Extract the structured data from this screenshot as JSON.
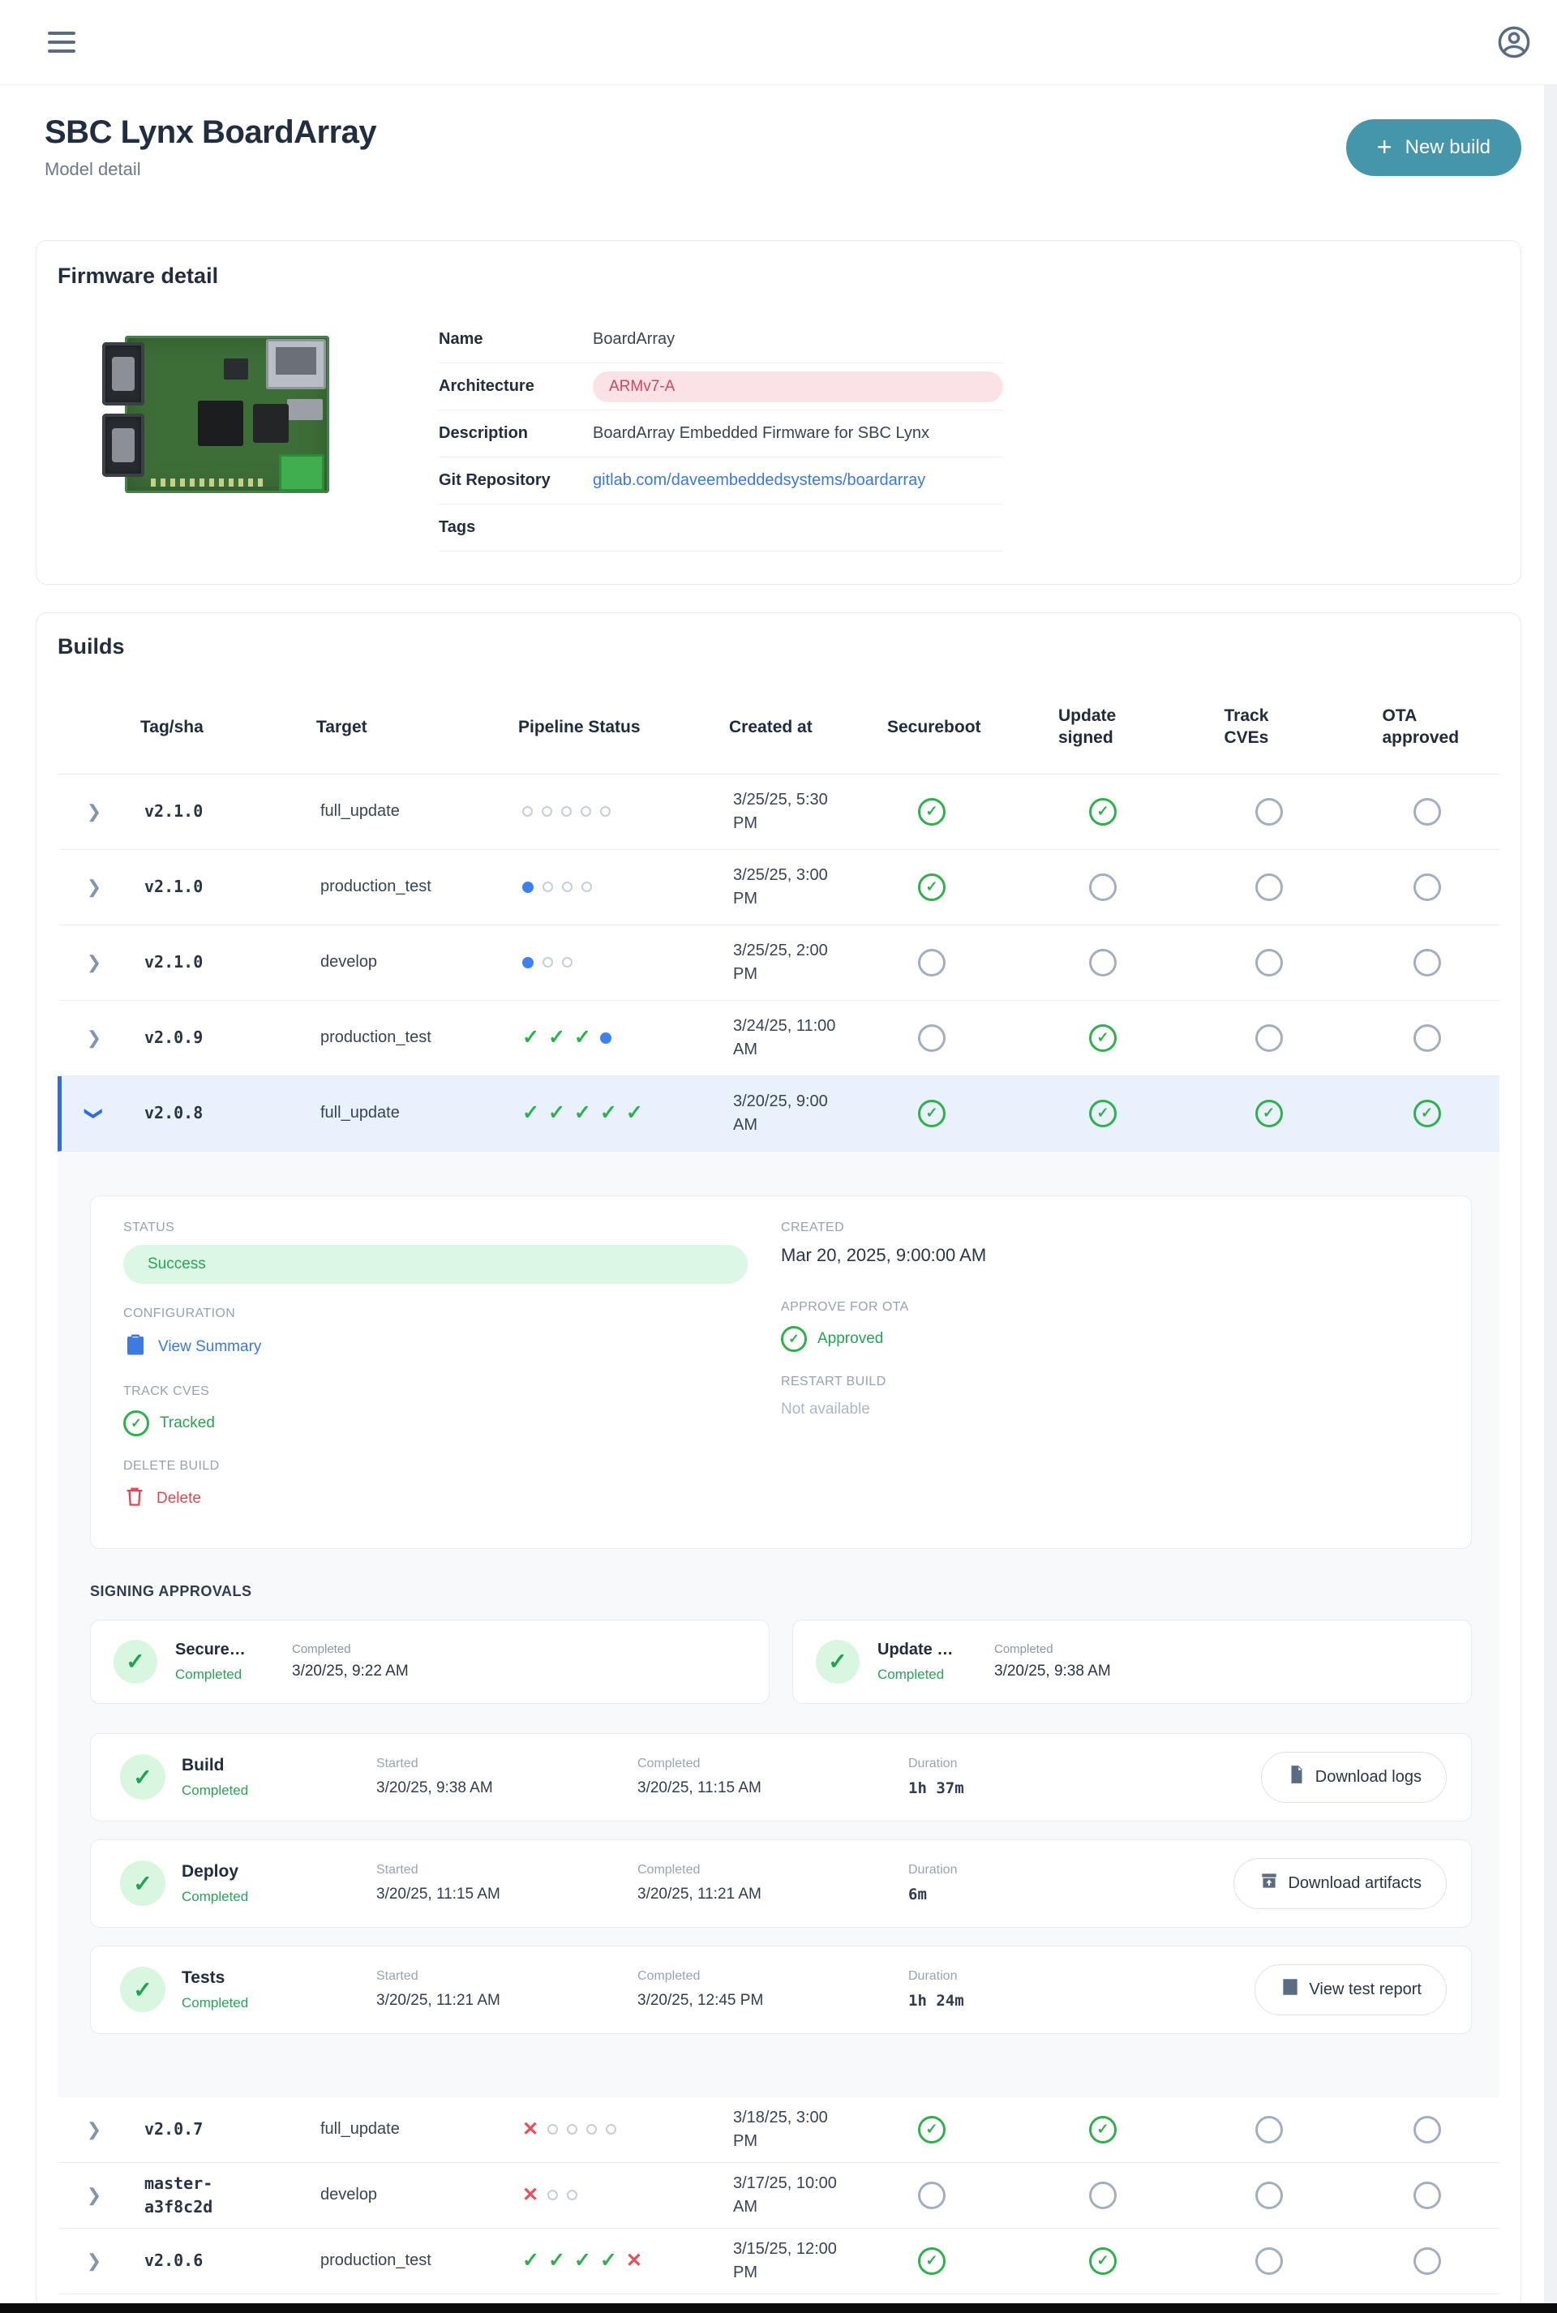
{
  "topbar": {
    "menu_icon": "hamburger-icon",
    "avatar_icon": "user-avatar-icon"
  },
  "header": {
    "title": "SBC Lynx BoardArray",
    "subtitle": "Model detail",
    "new_build_label": "New build",
    "accent_color": "#4596ab"
  },
  "firmware": {
    "heading": "Firmware detail",
    "fields": [
      {
        "label": "Name",
        "value": "BoardArray",
        "type": "text"
      },
      {
        "label": "Architecture",
        "value": "ARMv7-A",
        "type": "badge"
      },
      {
        "label": "Description",
        "value": "BoardArray Embedded Firmware for SBC Lynx",
        "type": "text"
      },
      {
        "label": "Git Repository",
        "value": "gitlab.com/daveembeddedsystems/boardarray",
        "type": "link"
      },
      {
        "label": "Tags",
        "value": "",
        "type": "text"
      }
    ],
    "badge_colors": {
      "bg": "#fbe2e6",
      "text": "#d5465e"
    },
    "link_color": "#3b78e0"
  },
  "builds": {
    "heading": "Builds",
    "columns": [
      "",
      "Tag/sha",
      "Target",
      "Pipeline Status",
      "Created at",
      "Secureboot",
      "Update signed",
      "Track CVEs",
      "OTA approved"
    ],
    "status_colors": {
      "pass": "#2db14a",
      "fail": "#e4515b",
      "running": "#3f80f0",
      "pending": "#c7cdd9"
    },
    "rows": [
      {
        "tag": "v2.1.0",
        "target": "full_update",
        "pipeline": [
          "pending",
          "pending",
          "pending",
          "pending",
          "pending"
        ],
        "created": "3/25/25, 5:30 PM",
        "secureboot": true,
        "update_signed": true,
        "track_cves": false,
        "ota_approved": false,
        "expanded": false
      },
      {
        "tag": "v2.1.0",
        "target": "production_test",
        "pipeline": [
          "running",
          "pending",
          "pending",
          "pending"
        ],
        "created": "3/25/25, 3:00 PM",
        "secureboot": true,
        "update_signed": false,
        "track_cves": false,
        "ota_approved": false,
        "expanded": false
      },
      {
        "tag": "v2.1.0",
        "target": "develop",
        "pipeline": [
          "running",
          "pending",
          "pending"
        ],
        "created": "3/25/25, 2:00 PM",
        "secureboot": false,
        "update_signed": false,
        "track_cves": false,
        "ota_approved": false,
        "expanded": false
      },
      {
        "tag": "v2.0.9",
        "target": "production_test",
        "pipeline": [
          "pass",
          "pass",
          "pass",
          "running"
        ],
        "created": "3/24/25, 11:00 AM",
        "secureboot": false,
        "update_signed": true,
        "track_cves": false,
        "ota_approved": false,
        "expanded": false
      },
      {
        "tag": "v2.0.8",
        "target": "full_update",
        "pipeline": [
          "pass",
          "pass",
          "pass",
          "pass",
          "pass"
        ],
        "created": "3/20/25, 9:00 AM",
        "secureboot": true,
        "update_signed": true,
        "track_cves": true,
        "ota_approved": true,
        "expanded": true
      },
      {
        "tag": "v2.0.7",
        "target": "full_update",
        "pipeline": [
          "fail",
          "pending",
          "pending",
          "pending",
          "pending"
        ],
        "created": "3/18/25, 3:00 PM",
        "secureboot": true,
        "update_signed": true,
        "track_cves": false,
        "ota_approved": false,
        "expanded": false,
        "compact": true
      },
      {
        "tag": "master-\na3f8c2d",
        "target": "develop",
        "pipeline": [
          "fail",
          "pending",
          "pending"
        ],
        "created": "3/17/25, 10:00 AM",
        "secureboot": false,
        "update_signed": false,
        "track_cves": false,
        "ota_approved": false,
        "expanded": false,
        "compact": true
      },
      {
        "tag": "v2.0.6",
        "target": "production_test",
        "pipeline": [
          "pass",
          "pass",
          "pass",
          "pass",
          "fail"
        ],
        "created": "3/15/25, 12:00 PM",
        "secureboot": true,
        "update_signed": true,
        "track_cves": false,
        "ota_approved": false,
        "expanded": false,
        "compact": true
      }
    ],
    "detail": {
      "status_label": "STATUS",
      "status_value": "Success",
      "created_label": "CREATED",
      "created_value": "Mar 20, 2025, 9:00:00 AM",
      "configuration_label": "CONFIGURATION",
      "configuration_action": "View Summary",
      "approve_label": "APPROVE FOR OTA",
      "approve_value": "Approved",
      "track_label": "TRACK CVES",
      "track_value": "Tracked",
      "restart_label": "RESTART BUILD",
      "restart_value": "Not available",
      "delete_label": "DELETE BUILD",
      "delete_action": "Delete",
      "signing_heading": "SIGNING APPROVALS",
      "approvals": [
        {
          "title": "Secure…",
          "status": "Completed",
          "completed_label": "Completed",
          "completed_at": "3/20/25, 9:22 AM"
        },
        {
          "title": "Update …",
          "status": "Completed",
          "completed_label": "Completed",
          "completed_at": "3/20/25, 9:38 AM"
        }
      ],
      "stage_labels": {
        "started": "Started",
        "completed": "Completed",
        "duration": "Duration"
      },
      "stages": [
        {
          "name": "Build",
          "status": "Completed",
          "started": "3/20/25, 9:38 AM",
          "completed": "3/20/25, 11:15 AM",
          "duration": "1h 37m",
          "action": "Download logs",
          "action_icon": "document-icon"
        },
        {
          "name": "Deploy",
          "status": "Completed",
          "started": "3/20/25, 11:15 AM",
          "completed": "3/20/25, 11:21 AM",
          "duration": "6m",
          "action": "Download artifacts",
          "action_icon": "archive-download-icon"
        },
        {
          "name": "Tests",
          "status": "Completed",
          "started": "3/20/25, 11:21 AM",
          "completed": "3/20/25, 12:45 PM",
          "duration": "1h 24m",
          "action": "View test report",
          "action_icon": "test-report-icon"
        }
      ]
    }
  }
}
